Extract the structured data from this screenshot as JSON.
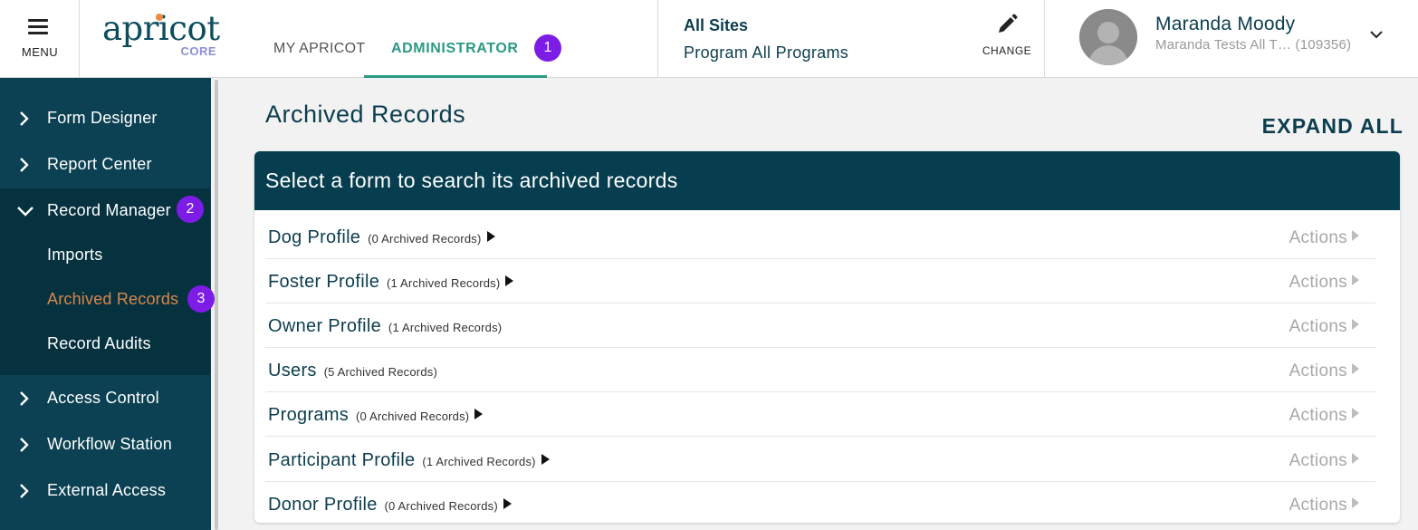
{
  "header": {
    "menu_label": "MENU",
    "logo_word": "apricot",
    "logo_core": "CORE",
    "tabs": [
      {
        "label": "MY APRICOT"
      },
      {
        "label": "ADMINISTRATOR"
      }
    ],
    "step_badges": [
      "1",
      "2",
      "3"
    ],
    "site_title": "All Sites",
    "program_line": "Program All Programs",
    "change_label": "CHANGE",
    "user": {
      "name": "Maranda Moody",
      "subtitle": "Maranda Tests All T…  (109356)"
    },
    "icons": {
      "menu": "hamburger-icon",
      "change": "pencil-icon",
      "user_menu": "chevron-down-icon",
      "avatar": "person-silhouette-icon"
    }
  },
  "sidebar": {
    "items": [
      {
        "label": "Form Designer"
      },
      {
        "label": "Report Center"
      },
      {
        "label": "Record Manager"
      },
      {
        "label": "Access Control"
      },
      {
        "label": "Workflow Station"
      },
      {
        "label": "External Access"
      }
    ],
    "record_manager_children": [
      {
        "label": "Imports"
      },
      {
        "label": "Archived Records"
      },
      {
        "label": "Record Audits"
      }
    ]
  },
  "main": {
    "title": "Archived Records",
    "expand_all": "EXPAND ALL",
    "card_heading": "Select a form to search its archived records",
    "actions_label": "Actions",
    "forms": [
      {
        "name": "Dog Profile",
        "count": "(0 Archived Records)"
      },
      {
        "name": "Foster Profile",
        "count": "(1 Archived Records)"
      },
      {
        "name": "Owner Profile",
        "count": "(1 Archived Records)"
      },
      {
        "name": "Users",
        "count": "(5 Archived Records)"
      },
      {
        "name": "Programs",
        "count": "(0 Archived Records)"
      },
      {
        "name": "Participant Profile",
        "count": "(1 Archived Records)"
      },
      {
        "name": "Donor Profile",
        "count": "(0 Archived Records)"
      }
    ]
  },
  "colors": {
    "brand_teal": "#0c3d4e",
    "sidebar_bg": "#0b4152",
    "active_tab": "#2a9a84",
    "active_nav": "#d9864a",
    "badge": "#7c1ce6"
  }
}
